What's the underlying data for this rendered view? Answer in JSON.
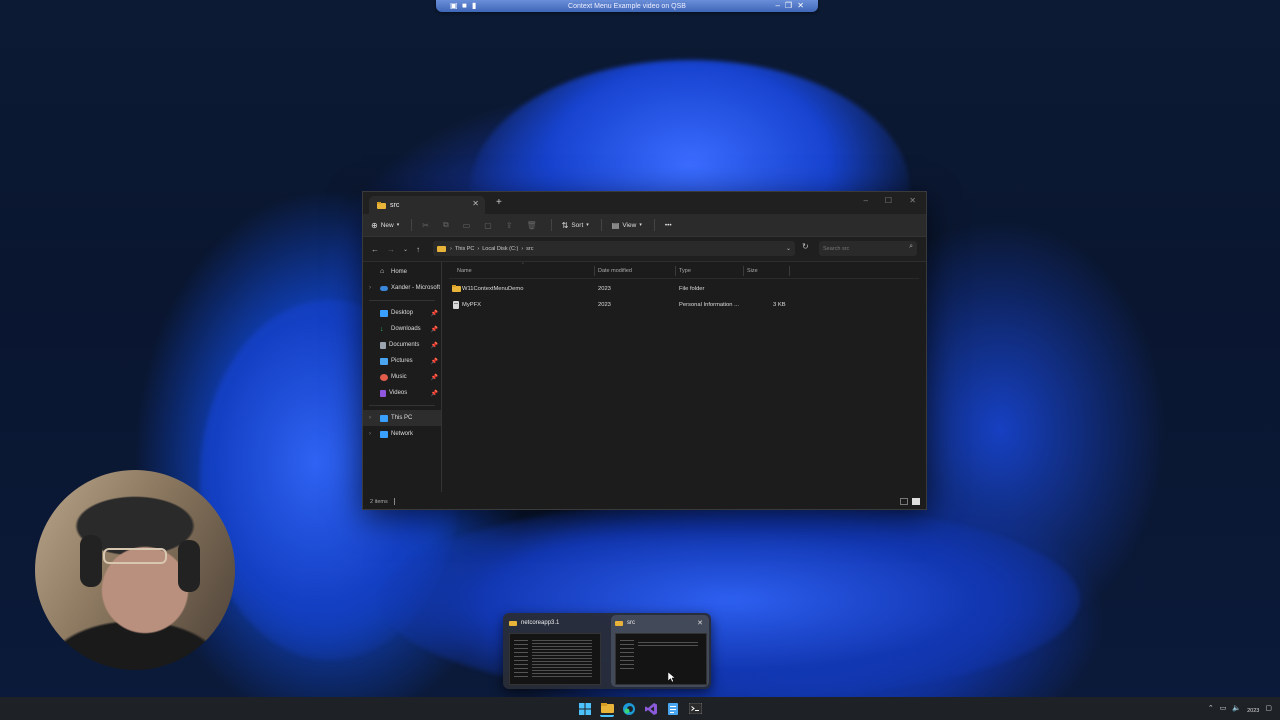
{
  "remote_bar": {
    "title": "Context Menu Example video on QSB"
  },
  "explorer": {
    "tab_title": "src",
    "toolbar": {
      "new_label": "New",
      "sort_label": "Sort",
      "view_label": "View",
      "more_label": "•••"
    },
    "breadcrumb": [
      "This PC",
      "Local Disk (C:)",
      "src"
    ],
    "search_placeholder": "Search src",
    "sidebar": {
      "top": [
        {
          "label": "Home",
          "icon": "home-icon"
        },
        {
          "label": "Xander - Microsoft",
          "icon": "cloud-icon"
        }
      ],
      "pinned": [
        {
          "label": "Desktop",
          "icon": "desktop-icon",
          "color": "#3aa0ff"
        },
        {
          "label": "Downloads",
          "icon": "download-icon",
          "color": "#2dbb6d"
        },
        {
          "label": "Documents",
          "icon": "document-icon",
          "color": "#9aa3b0"
        },
        {
          "label": "Pictures",
          "icon": "pictures-icon",
          "color": "#4aa6f0"
        },
        {
          "label": "Music",
          "icon": "music-icon",
          "color": "#e25b4b"
        },
        {
          "label": "Videos",
          "icon": "videos-icon",
          "color": "#8f56e0"
        }
      ],
      "bottom": [
        {
          "label": "This PC",
          "icon": "computer-icon",
          "color": "#3aa0ff"
        },
        {
          "label": "Network",
          "icon": "network-icon",
          "color": "#3aa0ff"
        }
      ]
    },
    "columns": [
      "Name",
      "Date modified",
      "Type",
      "Size"
    ],
    "files": [
      {
        "name": "W11ContextMenuDemo",
        "date": "2023",
        "type": "File folder",
        "size": "",
        "icon": "folder-icon"
      },
      {
        "name": "MyPFX",
        "date": "2023",
        "type": "Personal Information ...",
        "size": "3 KB",
        "icon": "file-icon"
      }
    ],
    "status": "2 items"
  },
  "thumbnails": [
    {
      "title": "netcoreapp3.1"
    },
    {
      "title": "src"
    }
  ],
  "taskbar": {
    "clock": "2023"
  },
  "colors": {
    "accent": "#0078d4",
    "folder": "#e8b339",
    "taskbar": "#1e2226",
    "window": "#1c1c1c"
  }
}
